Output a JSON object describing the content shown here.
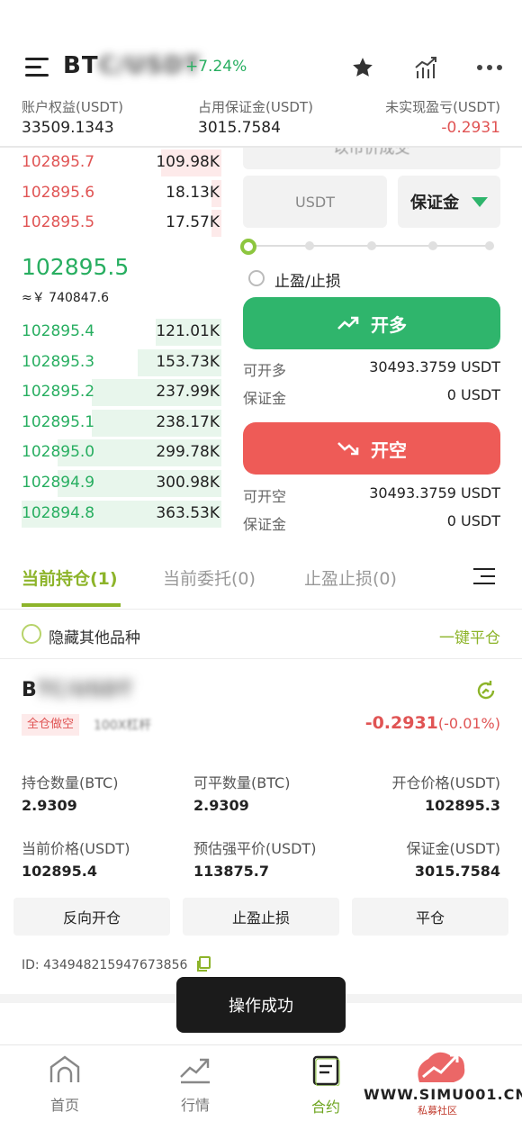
{
  "header": {
    "symbol_visible": "BT",
    "symbol_hidden": "C/USDT",
    "change": "+7.24%",
    "account": [
      {
        "label": "账户权益(USDT)",
        "value": "33509.1343"
      },
      {
        "label": "占用保证金(USDT)",
        "value": "3015.7584"
      },
      {
        "label": "未实现盈亏(USDT)",
        "value": "-0.2931"
      }
    ]
  },
  "orderbook": {
    "asks": [
      {
        "price": "102895.7",
        "qty": "109.98K",
        "depth": 0.3
      },
      {
        "price": "102895.6",
        "qty": "18.13K",
        "depth": 0.05
      },
      {
        "price": "102895.5",
        "qty": "17.57K",
        "depth": 0.05
      }
    ],
    "last_price": "102895.5",
    "last_cny": "≈￥ 740847.6",
    "bids": [
      {
        "price": "102895.4",
        "qty": "121.01K",
        "depth": 0.33
      },
      {
        "price": "102895.3",
        "qty": "153.73K",
        "depth": 0.42
      },
      {
        "price": "102895.2",
        "qty": "237.99K",
        "depth": 0.65
      },
      {
        "price": "102895.1",
        "qty": "238.17K",
        "depth": 0.65
      },
      {
        "price": "102895.0",
        "qty": "299.78K",
        "depth": 0.82
      },
      {
        "price": "102894.9",
        "qty": "300.98K",
        "depth": 0.82
      },
      {
        "price": "102894.8",
        "qty": "363.53K",
        "depth": 1.0
      }
    ]
  },
  "trade": {
    "price_placeholder": "以市价成交",
    "amount_unit": "USDT",
    "margin_select": "保证金",
    "tpsl_label": "止盈/止损",
    "long_label": "开多",
    "short_label": "开空",
    "long_info": [
      {
        "label": "可开多",
        "value": "30493.3759 USDT"
      },
      {
        "label": "保证金",
        "value": "0 USDT"
      }
    ],
    "short_info": [
      {
        "label": "可开空",
        "value": "30493.3759 USDT"
      },
      {
        "label": "保证金",
        "value": "0 USDT"
      }
    ]
  },
  "tabs": [
    "当前持仓(1)",
    "当前委托(0)",
    "止盈止损(0)"
  ],
  "filters": {
    "hide_others": "隐藏其他品种",
    "close_all": "一键平仓"
  },
  "position": {
    "symbol_visible": "B",
    "symbol_hidden": "TC/USDT",
    "badge": "全仓做空",
    "leverage": "100X杠杆",
    "pnl": "-0.2931",
    "pnl_pct": "(-0.01%)",
    "fields": [
      {
        "label": "持仓数量(BTC)",
        "value": "2.9309"
      },
      {
        "label": "可平数量(BTC)",
        "value": "2.9309"
      },
      {
        "label": "开仓价格(USDT)",
        "value": "102895.3"
      },
      {
        "label": "当前价格(USDT)",
        "value": "102895.4"
      },
      {
        "label": "预估强平价(USDT)",
        "value": "113875.7"
      },
      {
        "label": "保证金(USDT)",
        "value": "3015.7584"
      }
    ],
    "actions": [
      "反向开仓",
      "止盈止损",
      "平仓"
    ],
    "id": "ID: 434948215947673856"
  },
  "toast": "操作成功",
  "nav": [
    {
      "label": "首页",
      "icon": "home-icon"
    },
    {
      "label": "行情",
      "icon": "market-chart-icon"
    },
    {
      "label": "合约",
      "icon": "contract-doc-icon"
    }
  ],
  "watermark": {
    "text": "WWW.SIMU001.CN",
    "sub": "私募社区"
  },
  "colors": {
    "green": "#2fb56c",
    "red": "#ee5b57",
    "accent": "#8db42a"
  }
}
